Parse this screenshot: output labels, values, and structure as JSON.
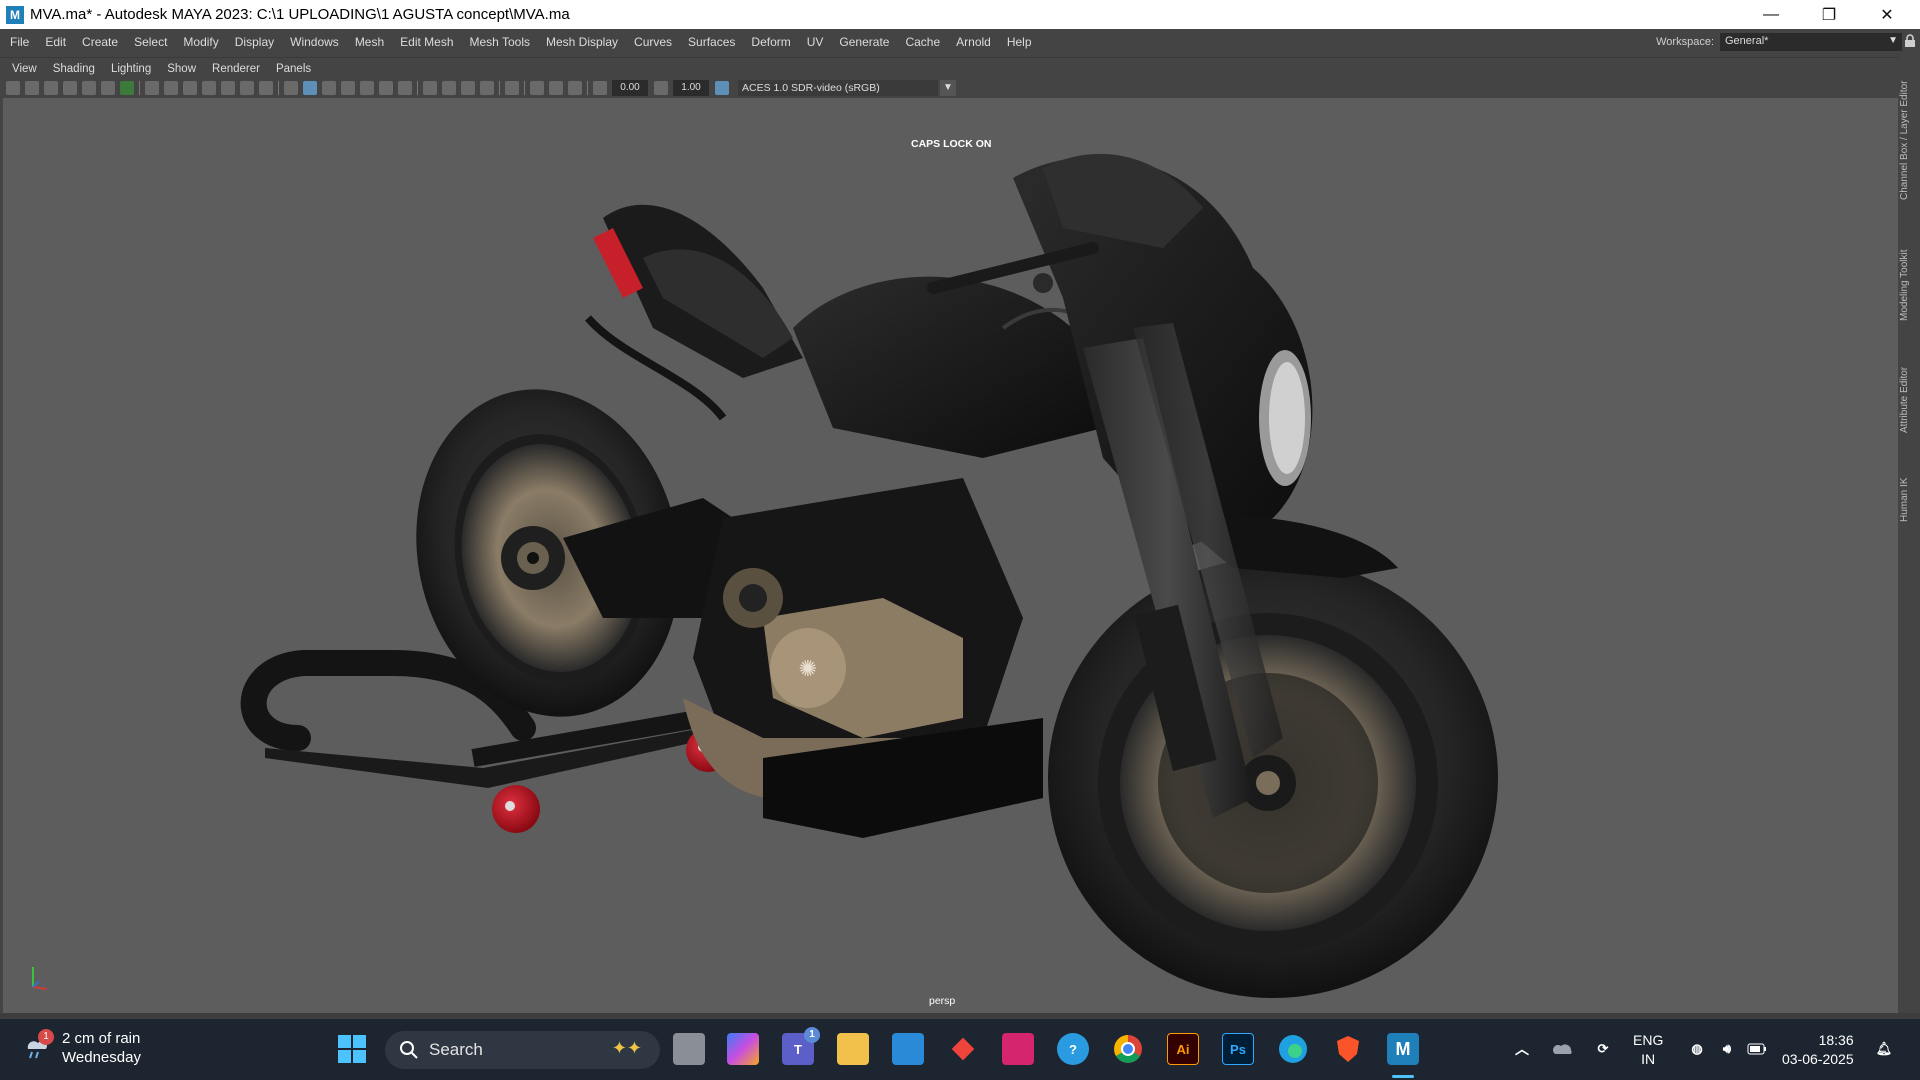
{
  "window": {
    "title": "MVA.ma* - Autodesk MAYA 2023: C:\\1 UPLOADING\\1 AGUSTA concept\\MVA.ma",
    "app_icon_letter": "M",
    "minimize_glyph": "—",
    "maximize_glyph": "❐",
    "close_glyph": "✕"
  },
  "menubar": {
    "items": [
      "File",
      "Edit",
      "Create",
      "Select",
      "Modify",
      "Display",
      "Windows",
      "Mesh",
      "Edit Mesh",
      "Mesh Tools",
      "Mesh Display",
      "Curves",
      "Surfaces",
      "Deform",
      "UV",
      "Generate",
      "Cache",
      "Arnold",
      "Help"
    ],
    "workspace_label": "Workspace:",
    "workspace_value": "General*"
  },
  "panel_menu": {
    "items": [
      "View",
      "Shading",
      "Lighting",
      "Show",
      "Renderer",
      "Panels"
    ]
  },
  "toolbar": {
    "exposure_value": "0.00",
    "gamma_value": "1.00",
    "color_space": "ACES 1.0 SDR-video (sRGB)"
  },
  "viewport": {
    "caps_lock_text": "CAPS LOCK ON",
    "camera_label": "persp",
    "body_color": "#1a1a1a",
    "accent_bronze": "#a89478",
    "stand_wheel_red": "#c4121c"
  },
  "right_tabs": [
    "Channel Box / Layer Editor",
    "Modeling Toolkit",
    "Attribute Editor",
    "Human IK"
  ],
  "taskbar": {
    "weather_badge": "1",
    "weather_line1": "2 cm of rain",
    "weather_line2": "Wednesday",
    "search_placeholder": "Search",
    "teams_badge": "1",
    "ai_label": "Ai",
    "ps_label": "Ps",
    "maya_label": "M",
    "lang_line1": "ENG",
    "lang_line2": "IN",
    "time": "18:36",
    "date": "03-06-2025"
  }
}
